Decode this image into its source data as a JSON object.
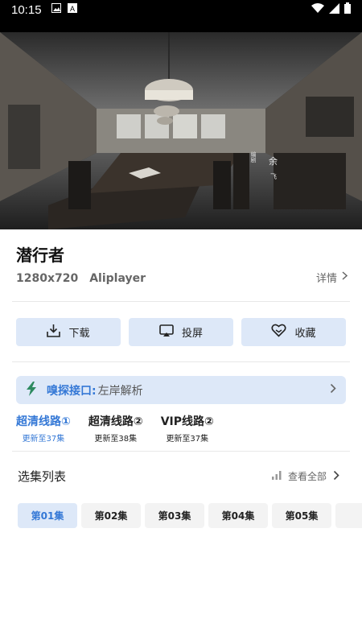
{
  "status": {
    "time": "10:15"
  },
  "video": {
    "credit_right": "余",
    "credit_sub": "飞",
    "credit_left": "编剧"
  },
  "title": "潜行者",
  "meta": {
    "resolution": "1280x720",
    "player": "Aliplayer"
  },
  "detail_label": "详情",
  "actions": [
    {
      "label": "下载",
      "icon": "download-icon"
    },
    {
      "label": "投屏",
      "icon": "cast-icon"
    },
    {
      "label": "收藏",
      "icon": "heart-icon"
    }
  ],
  "sniff": {
    "label": "嗅探接口:",
    "value": "左岸解析",
    "icon": "lightning-icon"
  },
  "lines": [
    {
      "name": "超清线路①",
      "sub": "更新至37集",
      "active": true
    },
    {
      "name": "超清线路②",
      "sub": "更新至38集",
      "active": false
    },
    {
      "name": "VIP线路②",
      "sub": "更新至37集",
      "active": false
    }
  ],
  "episodes_header": {
    "title": "选集列表",
    "view_all": "查看全部"
  },
  "episodes": [
    "第01集",
    "第02集",
    "第03集",
    "第04集",
    "第05集",
    ""
  ],
  "colors": {
    "accent": "#3478d6",
    "button_bg": "#dde8f8"
  }
}
